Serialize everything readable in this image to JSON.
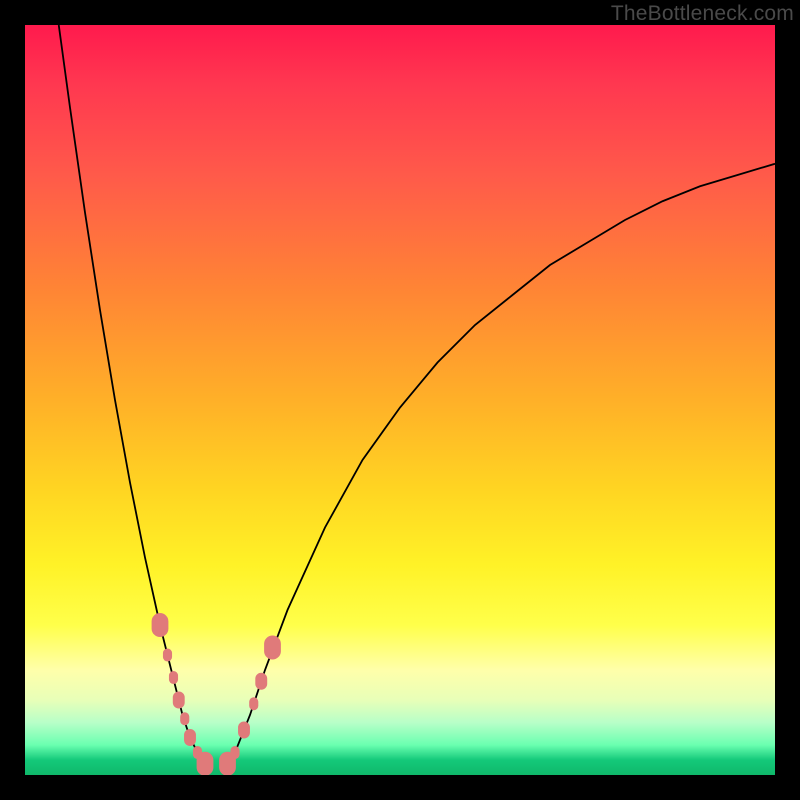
{
  "watermark": "TheBottleneck.com",
  "colors": {
    "gradient_top": "#ff1a4d",
    "gradient_bottom": "#0fb86a",
    "curve": "#000000",
    "marker": "#e07a7a",
    "frame": "#000000"
  },
  "chart_data": {
    "type": "line",
    "title": "",
    "xlabel": "",
    "ylabel": "",
    "xlim": [
      0,
      100
    ],
    "ylim": [
      0,
      100
    ],
    "series": [
      {
        "name": "left-branch",
        "x": [
          4.5,
          6,
          8,
          10,
          12,
          14,
          16,
          18,
          20,
          21,
          22,
          23,
          24
        ],
        "y": [
          100,
          89,
          75,
          62,
          50,
          39,
          29,
          20,
          12,
          8,
          5,
          3,
          1.5
        ]
      },
      {
        "name": "right-branch",
        "x": [
          27,
          28,
          30,
          32,
          35,
          40,
          45,
          50,
          55,
          60,
          65,
          70,
          75,
          80,
          85,
          90,
          95,
          100
        ],
        "y": [
          1.5,
          3,
          8,
          14,
          22,
          33,
          42,
          49,
          55,
          60,
          64,
          68,
          71,
          74,
          76.5,
          78.5,
          80,
          81.5
        ]
      }
    ],
    "markers": [
      {
        "branch": "left",
        "x": 18,
        "y": 20,
        "size": "large"
      },
      {
        "branch": "left",
        "x": 19,
        "y": 16,
        "size": "small"
      },
      {
        "branch": "left",
        "x": 19.8,
        "y": 13,
        "size": "small"
      },
      {
        "branch": "left",
        "x": 20.5,
        "y": 10,
        "size": "med"
      },
      {
        "branch": "left",
        "x": 21.3,
        "y": 7.5,
        "size": "small"
      },
      {
        "branch": "left",
        "x": 22,
        "y": 5,
        "size": "med"
      },
      {
        "branch": "left",
        "x": 23,
        "y": 3,
        "size": "small"
      },
      {
        "branch": "left",
        "x": 24,
        "y": 1.5,
        "size": "large"
      },
      {
        "branch": "right",
        "x": 27,
        "y": 1.5,
        "size": "large"
      },
      {
        "branch": "right",
        "x": 28,
        "y": 3,
        "size": "small"
      },
      {
        "branch": "right",
        "x": 29.2,
        "y": 6,
        "size": "med"
      },
      {
        "branch": "right",
        "x": 30.5,
        "y": 9.5,
        "size": "small"
      },
      {
        "branch": "right",
        "x": 31.5,
        "y": 12.5,
        "size": "med"
      },
      {
        "branch": "right",
        "x": 33,
        "y": 17,
        "size": "large"
      }
    ],
    "marker_sizes": {
      "small": 6.5,
      "med": 8.5,
      "large": 12
    }
  }
}
